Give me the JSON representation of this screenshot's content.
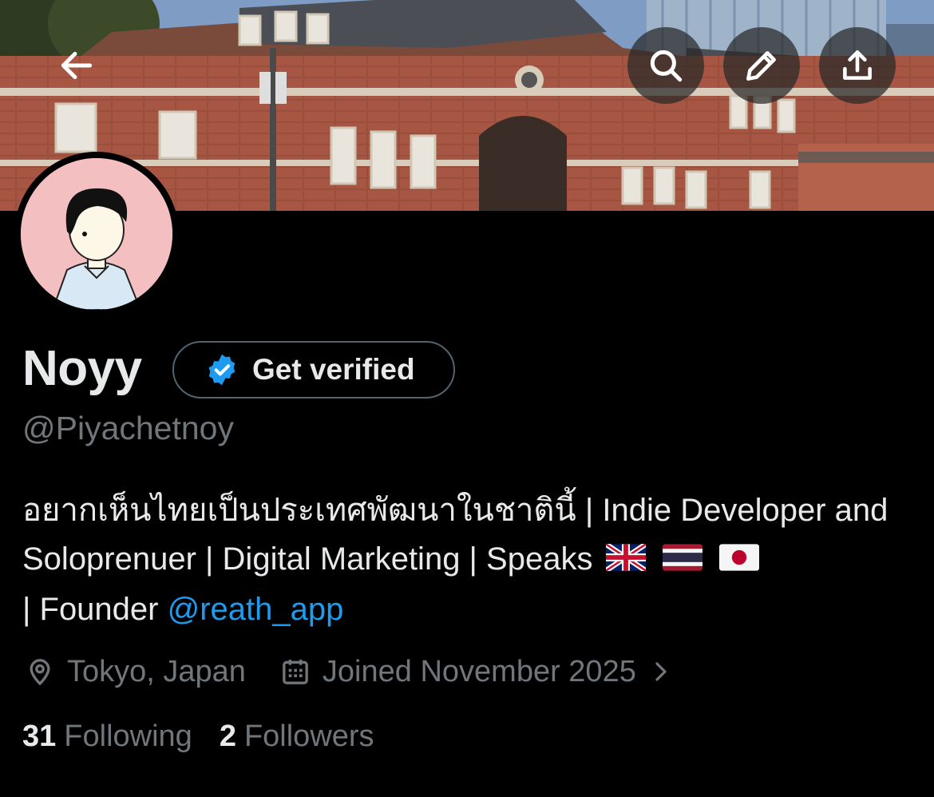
{
  "profile": {
    "name": "Noyy",
    "handle": "@Piyachetnoy",
    "verify_label": "Get verified",
    "bio_prefix": "อยากเห็นไทยเป็นประเทศพัฒนาในชาตินี้ | Indie Developer and Soloprenuer | Digital Marketing | Speaks",
    "bio_founder": "| Founder",
    "bio_mention": "@reath_app",
    "flags": [
      "UK",
      "Thailand",
      "Japan"
    ],
    "location": "Tokyo, Japan",
    "joined": "Joined November 2025",
    "following_count": "31",
    "following_label": "Following",
    "followers_count": "2",
    "followers_label": "Followers"
  },
  "header": {
    "buttons": [
      "back-arrow-icon",
      "search-icon",
      "pencil-icon",
      "share-icon"
    ]
  },
  "colors": {
    "background": "#000000",
    "text": "#e7e9ea",
    "muted": "#71767b",
    "accent": "#1d9bf0",
    "avatar_bg": "#f4bfc1"
  }
}
